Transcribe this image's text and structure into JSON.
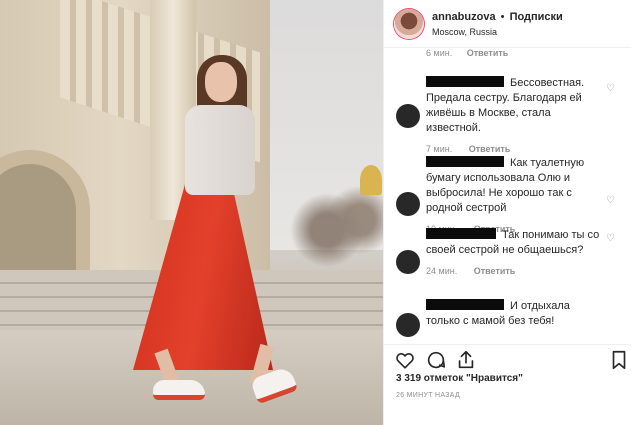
{
  "post": {
    "username": "annabuzova",
    "separator": "•",
    "follow_label": "Подписки",
    "location": "Moscow, Russia"
  },
  "top_meta": {
    "time": "6 мин.",
    "reply": "Ответить"
  },
  "comments": [
    {
      "text": "Бессовестная. Предала сестру. Благодаря ей живёшь в Москве, стала известной.",
      "time": "7 мин.",
      "reply": "Ответить"
    },
    {
      "text": "Как туалетную бумагу использовала Олю и выбросила! Не хорошо так с родной сестрой",
      "time": "10 мин.",
      "reply": "Ответить"
    },
    {
      "text": "Так понимаю ты со своей сестрой не общаешься?",
      "time": "24 мин.",
      "reply": "Ответить"
    },
    {
      "text": "И отдыхала только с мамой без тебя!",
      "time": "",
      "reply": ""
    }
  ],
  "likes": "3 319 отметок \"Нравится\"",
  "timestamp": "26 МИНУТ НАЗАД",
  "icons": {
    "like": "heart-icon",
    "comment": "comment-bubble-icon",
    "share": "share-icon",
    "save": "bookmark-icon"
  },
  "colors": {
    "text": "#262626",
    "muted": "#8e8e8e",
    "redaction": "#0b0b0b",
    "skirt": "#d0301e"
  }
}
